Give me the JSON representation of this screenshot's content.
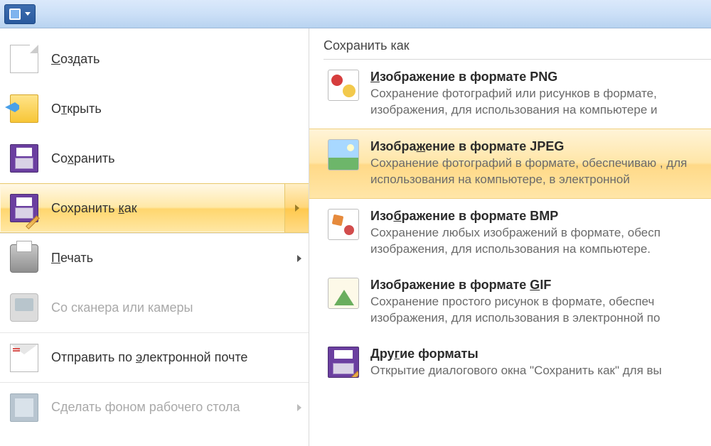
{
  "titlebar": {
    "app_hint": "paint-like app"
  },
  "left_menu": {
    "items": [
      {
        "id": "new",
        "label": "Создать",
        "hotkey_char": "С"
      },
      {
        "id": "open",
        "label": "Открыть",
        "hotkey_char": "т"
      },
      {
        "id": "save",
        "label": "Сохранить",
        "hotkey_char": "х"
      },
      {
        "id": "save_as",
        "label": "Сохранить как",
        "hotkey_char": "к",
        "has_submenu": true,
        "selected": true
      },
      {
        "id": "print",
        "label": "Печать",
        "hotkey_char": "П",
        "has_submenu": true
      },
      {
        "id": "scanner",
        "label": "Со сканера или камеры",
        "disabled": true
      },
      {
        "id": "email",
        "label": "Отправить по электронной почте",
        "hotkey_char": "э"
      },
      {
        "id": "wallpaper",
        "label": "Сделать фоном рабочего стола",
        "disabled": true,
        "has_submenu": true
      }
    ]
  },
  "right_panel": {
    "header": "Сохранить как",
    "options": [
      {
        "id": "png",
        "title": "Изображение в формате PNG",
        "hotkey_char": "И",
        "desc": "Сохранение фотографий или рисунков в формате, изображения, для использования на компьютере и"
      },
      {
        "id": "jpeg",
        "title": "Изображение в формате JPEG",
        "hotkey_char": "ж",
        "desc": "Сохранение фотографий в формате, обеспечиваю , для использования на компьютере, в электронной",
        "highlight": true
      },
      {
        "id": "bmp",
        "title": "Изображение в формате BMP",
        "hotkey_char": "б",
        "desc": "Сохранение любых изображений в формате, обесп изображения, для использования на компьютере."
      },
      {
        "id": "gif",
        "title": "Изображение в формате GIF",
        "hotkey_char": "G",
        "desc": "Сохранение простого рисунок в формате, обеспеч изображения, для использования в электронной по"
      },
      {
        "id": "other",
        "title": "Другие форматы",
        "hotkey_char": "г",
        "desc": "Открытие диалогового окна \"Сохранить как\" для вы"
      }
    ]
  }
}
